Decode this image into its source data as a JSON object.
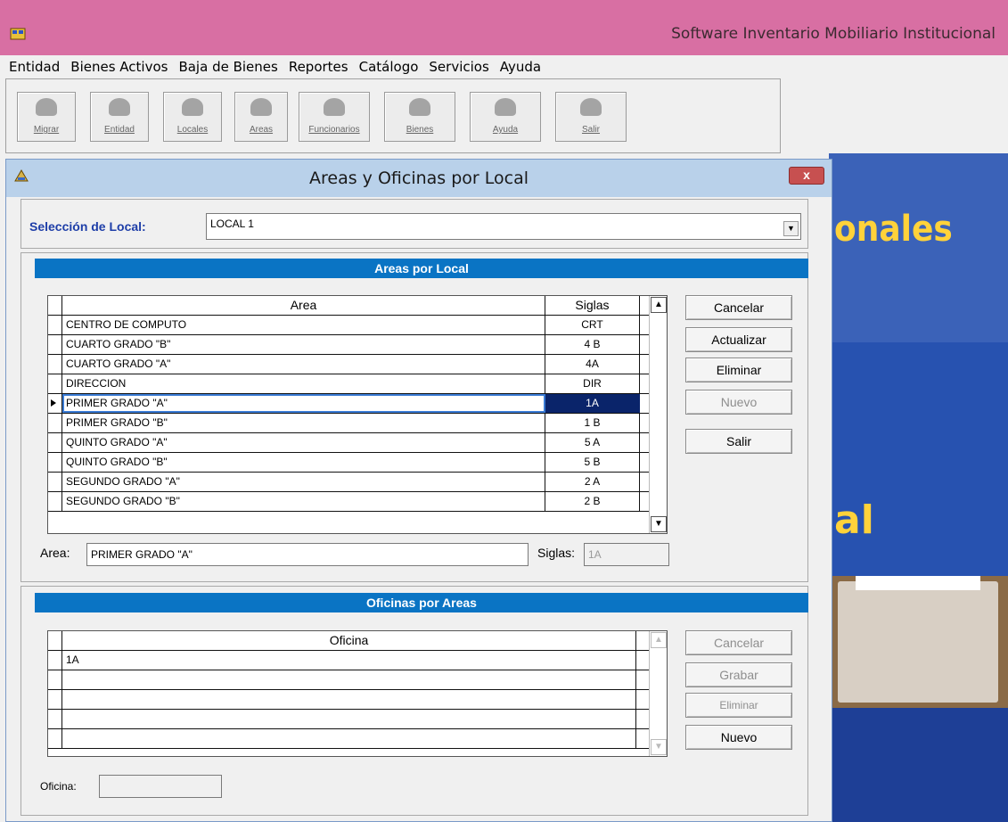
{
  "window": {
    "title": "Software Inventario Mobiliario Institucional"
  },
  "menu": [
    "Entidad",
    "Bienes Activos",
    "Baja de Bienes",
    "Reportes",
    "Catálogo",
    "Servicios",
    "Ayuda"
  ],
  "toolbar": [
    {
      "label": "Migrar",
      "icon": "migrate-icon"
    },
    {
      "label": "Entidad",
      "icon": "entity-icon"
    },
    {
      "label": "Locales",
      "icon": "locales-icon"
    },
    {
      "label": "Areas",
      "icon": "areas-icon"
    },
    {
      "label": "Funcionarios",
      "icon": "employees-icon"
    },
    {
      "label": "Bienes",
      "icon": "assets-icon"
    },
    {
      "label": "Ayuda",
      "icon": "help-icon"
    },
    {
      "label": "Salir",
      "icon": "exit-icon"
    }
  ],
  "splash": {
    "text1": "onales",
    "text2": "al"
  },
  "dialog": {
    "title": "Areas y Oficinas por Local",
    "close": "x",
    "local_label": "Selección de Local:",
    "local_value": "LOCAL 1",
    "areas": {
      "header": "Areas por Local",
      "col_area": "Area",
      "col_siglas": "Siglas",
      "rows": [
        {
          "area": "CENTRO DE COMPUTO",
          "siglas": "CRT"
        },
        {
          "area": "CUARTO  GRADO \"B\"",
          "siglas": "4 B"
        },
        {
          "area": "CUARTO GRADO  \"A\"",
          "siglas": "4A"
        },
        {
          "area": "DIRECCION",
          "siglas": "DIR"
        },
        {
          "area": "PRIMER GRADO  \"A\"",
          "siglas": "1A"
        },
        {
          "area": "PRIMER GRADO \"B\"",
          "siglas": "1 B"
        },
        {
          "area": "QUINTO GRADO  \"A\"",
          "siglas": "5 A"
        },
        {
          "area": "QUINTO GRADO \"B\"",
          "siglas": "5 B"
        },
        {
          "area": "SEGUNDO GRADO \"A\"",
          "siglas": "2 A"
        },
        {
          "area": "SEGUNDO GRADO \"B\"",
          "siglas": "2 B"
        }
      ],
      "selected_index": 4,
      "area_label": "Area:",
      "area_value": "PRIMER GRADO  \"A\"",
      "siglas_label": "Siglas:",
      "siglas_value": "1A",
      "buttons": {
        "cancelar": "Cancelar",
        "actualizar": "Actualizar",
        "eliminar": "Eliminar",
        "nuevo": "Nuevo",
        "salir": "Salir"
      }
    },
    "oficinas": {
      "header": "Oficinas por Areas",
      "col_oficina": "Oficina",
      "rows": [
        "1A",
        "",
        "",
        "",
        ""
      ],
      "oficina_label": "Oficina:",
      "oficina_value": "",
      "buttons": {
        "cancelar": "Cancelar",
        "grabar": "Grabar",
        "eliminar": "Eliminar",
        "nuevo": "Nuevo"
      }
    }
  }
}
